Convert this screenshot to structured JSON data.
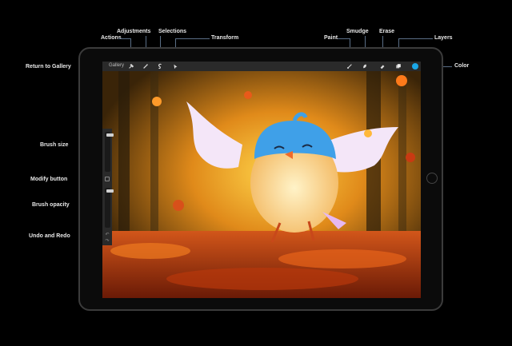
{
  "callouts": {
    "actions": "Actions",
    "adjustments": "Adjustments",
    "selections": "Selections",
    "transform": "Transform",
    "paint": "Paint",
    "smudge": "Smudge",
    "erase": "Erase",
    "layers": "Layers",
    "color": "Color",
    "return_to_gallery": "Return to Gallery",
    "brush_size": "Brush size",
    "modify_button": "Modify button",
    "brush_opacity": "Brush opacity",
    "undo_and_redo": "Undo and Redo"
  },
  "app": {
    "gallery_label": "Gallery",
    "tools_left": [
      {
        "name": "wrench-icon"
      },
      {
        "name": "magic-wand-icon"
      },
      {
        "name": "selection-s-icon"
      },
      {
        "name": "arrow-cursor-icon"
      }
    ],
    "tools_right": [
      {
        "name": "brush-icon"
      },
      {
        "name": "smudge-finger-icon"
      },
      {
        "name": "eraser-icon"
      },
      {
        "name": "layers-icon"
      }
    ],
    "current_color": "#1aa7e8",
    "brush_size_level": 0.95,
    "brush_opacity_level": 0.95
  }
}
